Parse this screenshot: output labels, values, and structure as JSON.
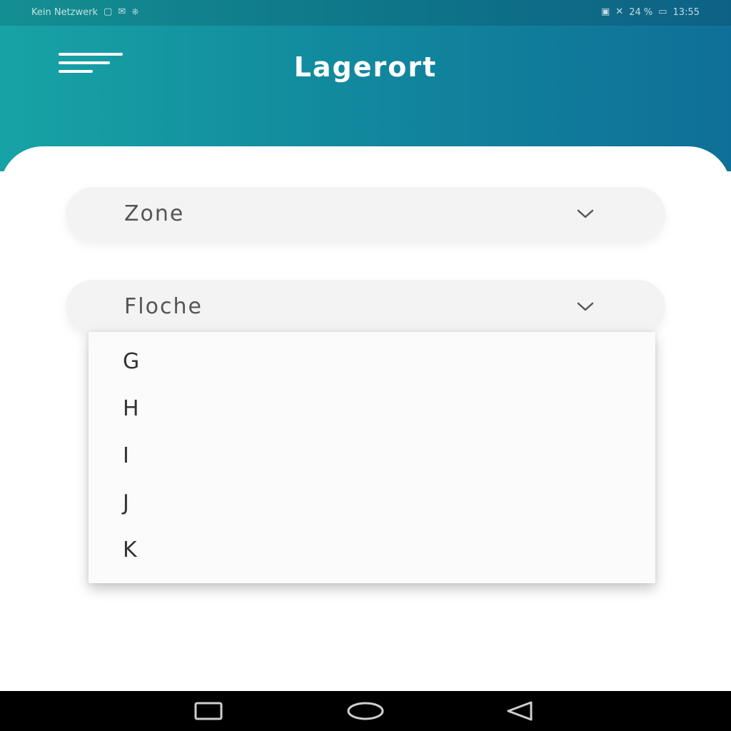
{
  "status_bar": {
    "left_text": "Kein Netzwerk",
    "left_icons": [
      "sim-icon",
      "notification-icon",
      "usb-icon"
    ],
    "right_icons": [
      "nfc-icon",
      "silent-icon"
    ],
    "battery_text": "24 %",
    "time": "13:55"
  },
  "app_bar": {
    "title": "Lagerort",
    "menu_icon": "hamburger-menu-icon"
  },
  "form": {
    "zone_label": "Zone",
    "floche_label": "Floche"
  },
  "dropdown": {
    "items": [
      "G",
      "H",
      "I",
      "J",
      "K"
    ]
  },
  "nav_bar": {
    "buttons": [
      "recents-icon",
      "home-icon",
      "back-icon"
    ]
  },
  "colors": {
    "header_gradient_start": "#17a3a5",
    "header_gradient_end": "#0f6f98",
    "select_background": "#f3f3f3",
    "text_primary": "#333333"
  }
}
